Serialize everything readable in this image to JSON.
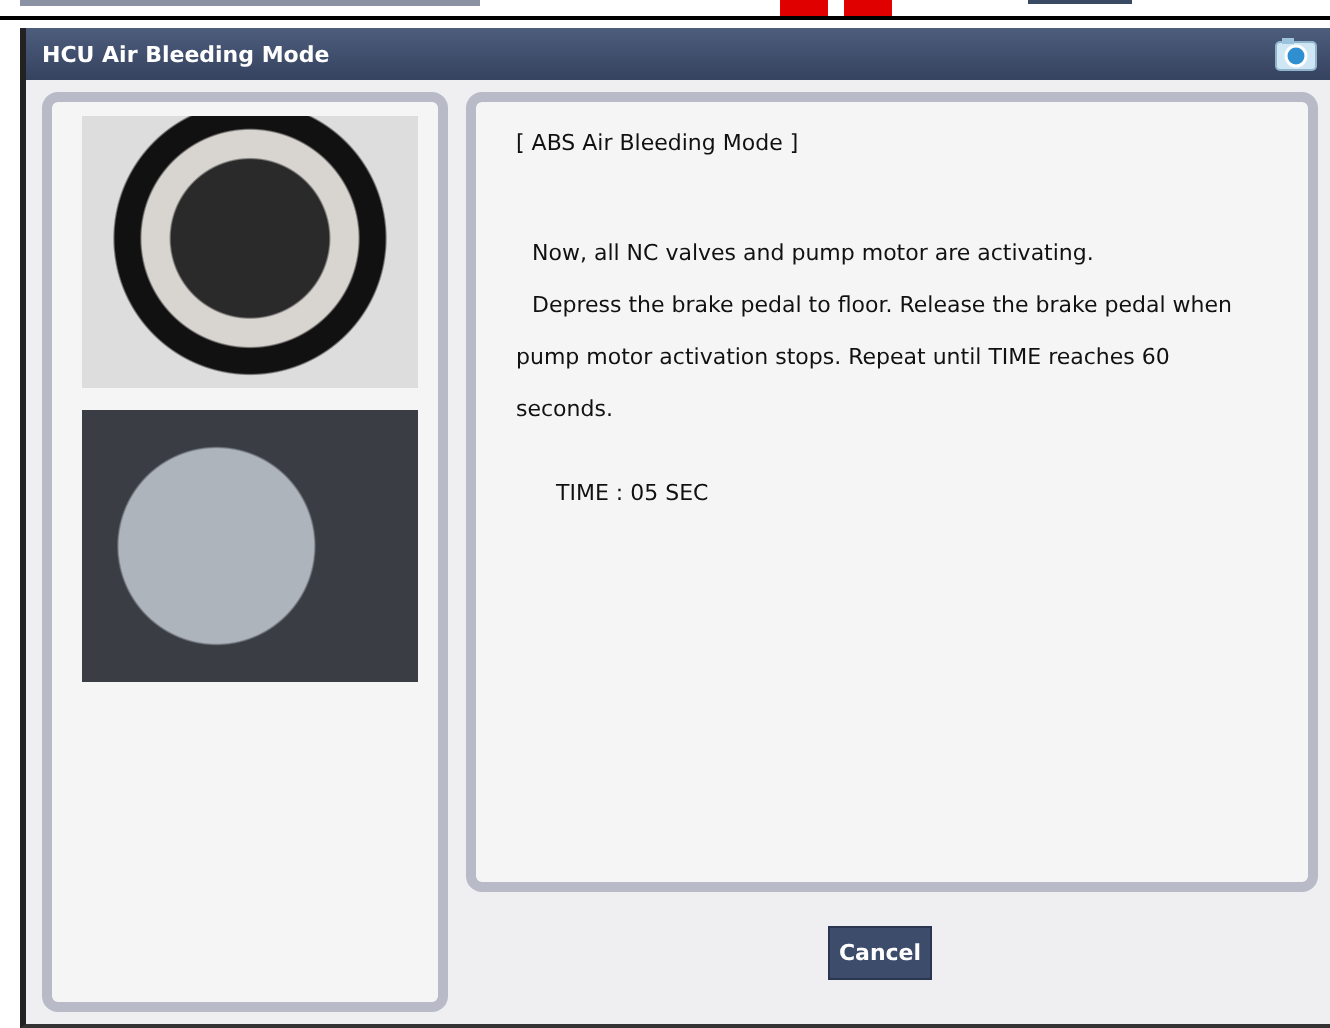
{
  "window": {
    "title": "HCU Air Bleeding Mode"
  },
  "message": {
    "heading": "[ ABS Air Bleeding Mode ]",
    "paragraphs": [
      "Now, all NC valves and pump motor are activating.",
      "Depress the brake pedal to floor. Release the brake pedal when pump motor activation stops. Repeat until TIME reaches 60 seconds."
    ],
    "time": "TIME : 05 SEC"
  },
  "buttons": [
    {
      "label": "Cancel"
    }
  ]
}
